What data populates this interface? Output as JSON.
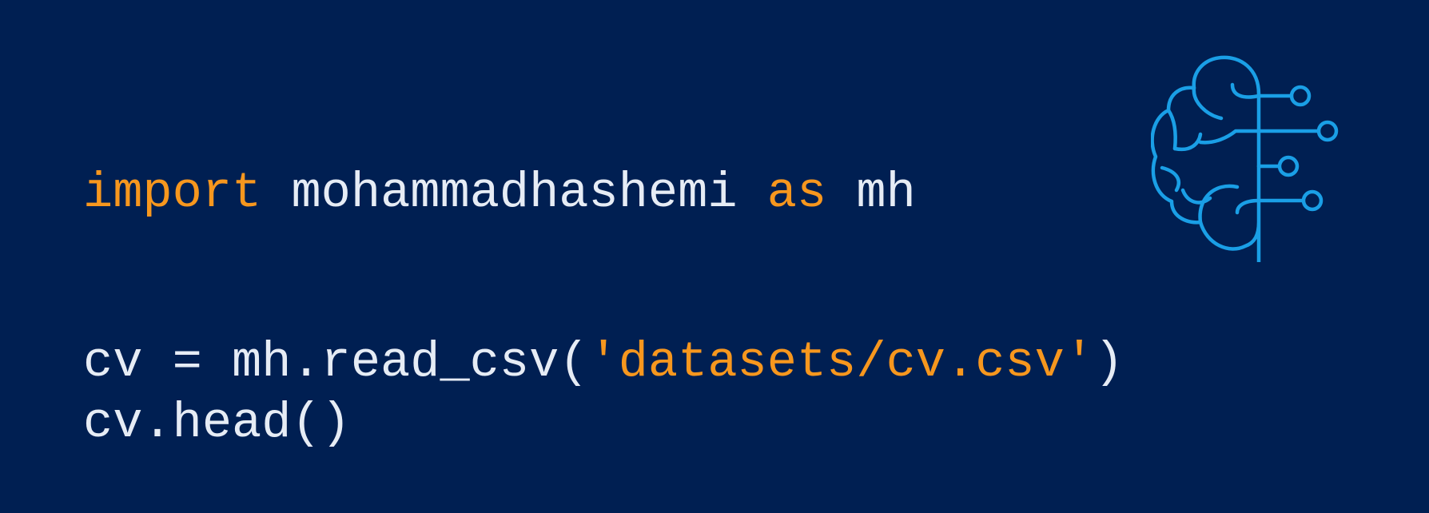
{
  "code": {
    "line1": {
      "kw_import": "import",
      "module": " mohammadhashemi ",
      "kw_as": "as",
      "alias": " mh"
    },
    "line2": {
      "prefix": "cv = mh.read_csv(",
      "string": "'datasets/cv.csv'",
      "suffix": ")"
    },
    "line3": {
      "text": "cv.head()"
    }
  },
  "icon": "brain-circuit-icon",
  "colors": {
    "background": "#001f52",
    "keyword": "#f7971e",
    "text": "#e6ecf5",
    "icon": "#1a9fe6"
  }
}
